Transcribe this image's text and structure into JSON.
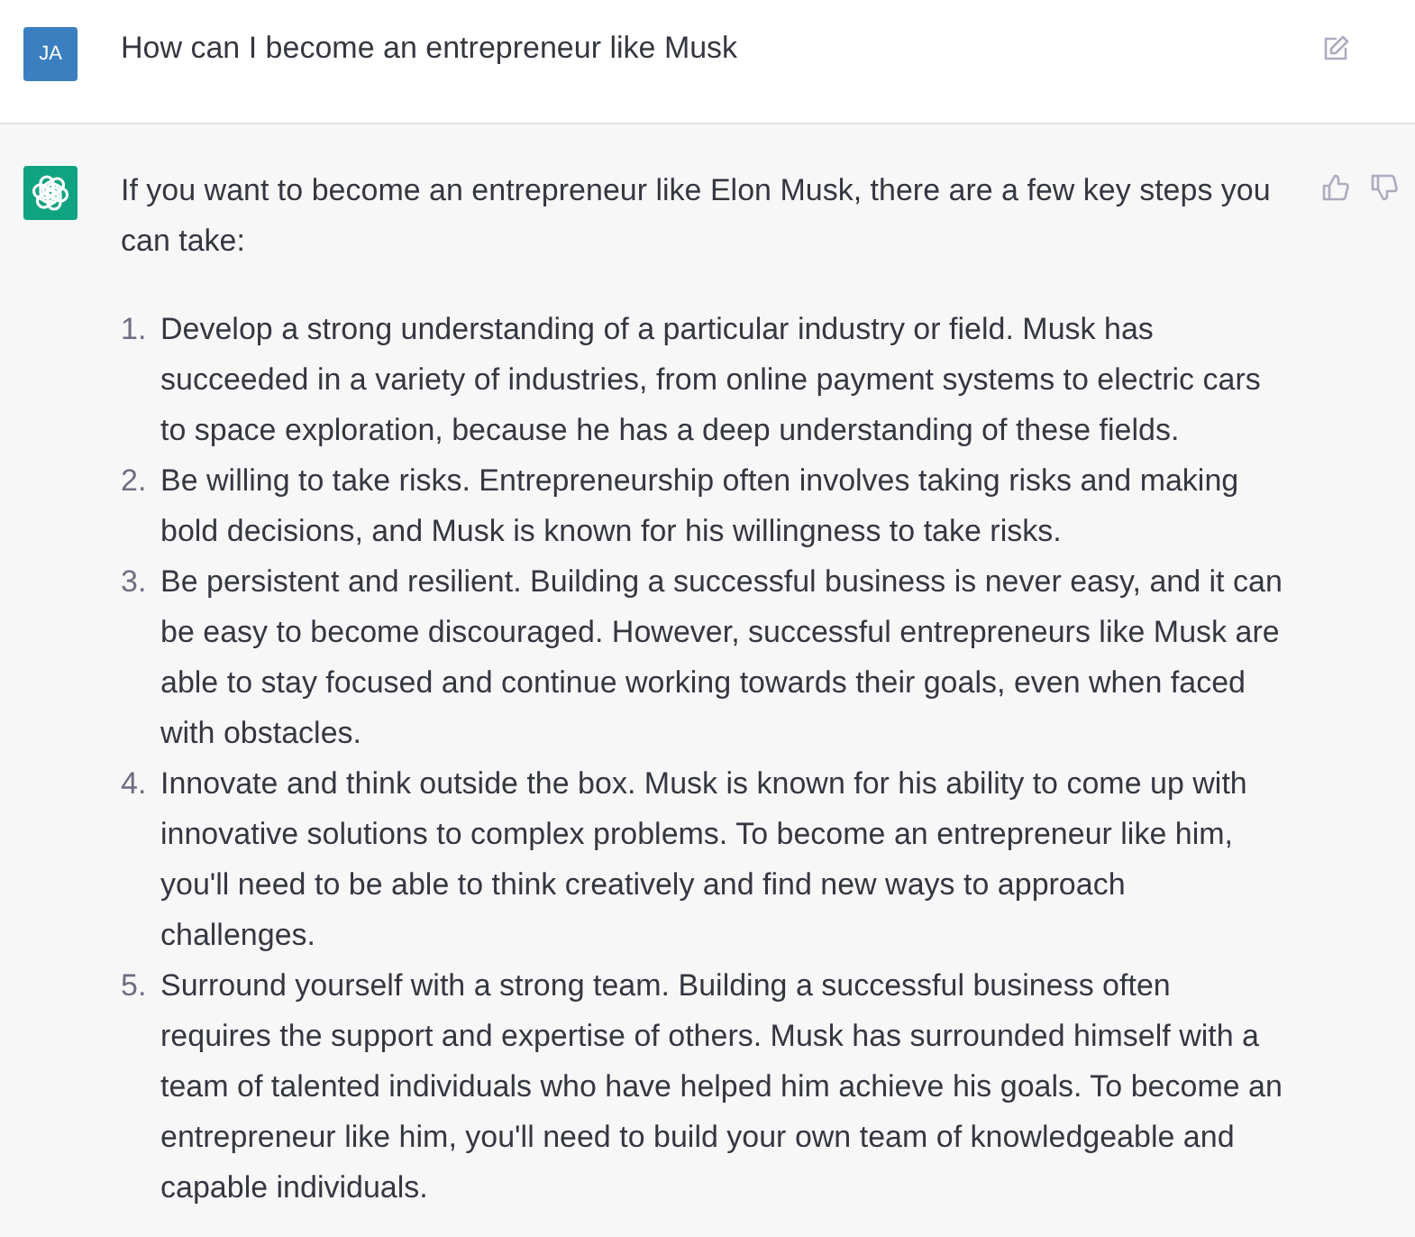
{
  "user_message": {
    "avatar_initials": "JA",
    "text": "How can I become an entrepreneur like Musk"
  },
  "assistant_message": {
    "intro": "If you want to become an entrepreneur like Elon Musk, there are a few key steps you can take:",
    "steps": [
      {
        "number": "1.",
        "text": "Develop a strong understanding of a particular industry or field. Musk has succeeded in a variety of industries, from online payment systems to electric cars to space exploration, because he has a deep understanding of these fields."
      },
      {
        "number": "2.",
        "text": "Be willing to take risks. Entrepreneurship often involves taking risks and making bold decisions, and Musk is known for his willingness to take risks."
      },
      {
        "number": "3.",
        "text": "Be persistent and resilient. Building a successful business is never easy, and it can be easy to become discouraged. However, successful entrepreneurs like Musk are able to stay focused and continue working towards their goals, even when faced with obstacles."
      },
      {
        "number": "4.",
        "text": "Innovate and think outside the box. Musk is known for his ability to come up with innovative solutions to complex problems. To become an entrepreneur like him, you'll need to be able to think creatively and find new ways to approach challenges."
      },
      {
        "number": "5.",
        "text": "Surround yourself with a strong team. Building a successful business often requires the support and expertise of others. Musk has surrounded himself with a team of talented individuals who have helped him achieve his goals. To become an entrepreneur like him, you'll need to build your own team of knowledgeable and capable individuals."
      }
    ]
  }
}
